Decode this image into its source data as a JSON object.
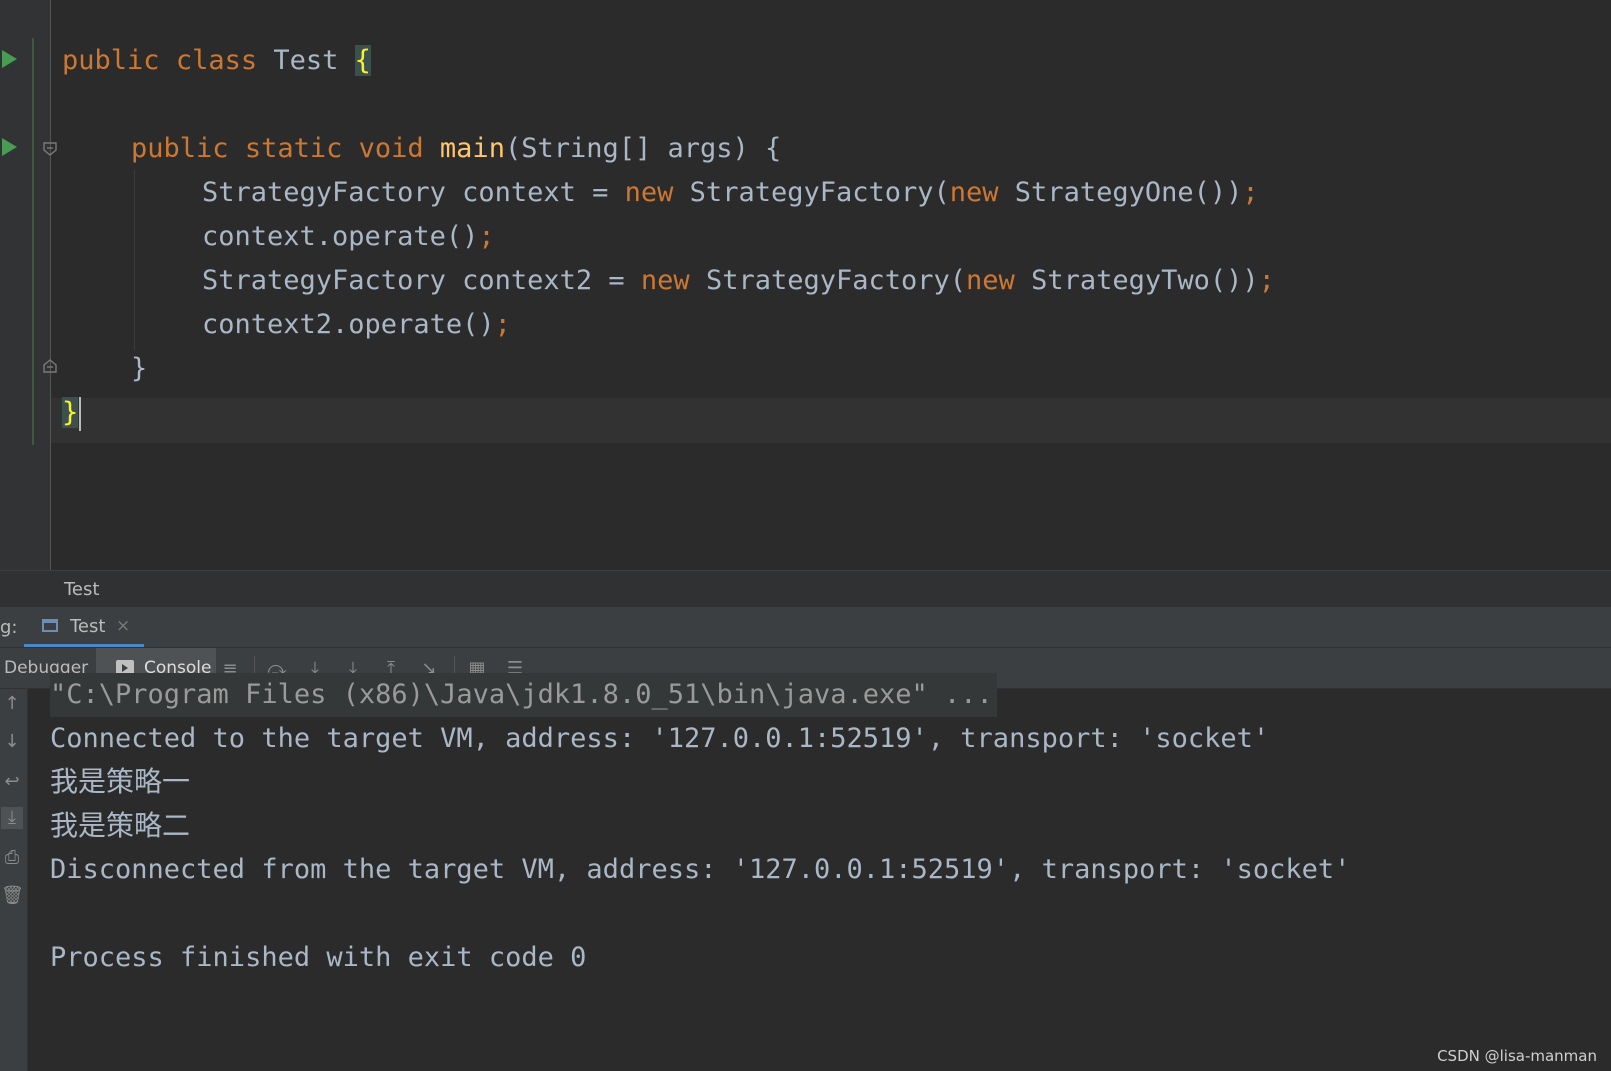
{
  "editor": {
    "lines": {
      "l1": {
        "kw1": "public",
        "kw2": "class",
        "name": "Test",
        "brace": "{"
      },
      "l2": {
        "kw1": "public",
        "kw2": "static",
        "kw3": "void",
        "fn": "main",
        "rest": "(String[] args) {"
      },
      "l3": {
        "a": "StrategyFactory context = ",
        "kw": "new",
        "b": " StrategyFactory(",
        "kw2": "new",
        "c": " StrategyOne())",
        "semi": ";"
      },
      "l4": {
        "a": "context.operate()",
        "semi": ";"
      },
      "l5": {
        "a": "StrategyFactory context2 = ",
        "kw": "new",
        "b": " StrategyFactory(",
        "kw2": "new",
        "c": " StrategyTwo())",
        "semi": ";"
      },
      "l6": {
        "a": "context2.operate()",
        "semi": ";"
      },
      "l7": {
        "a": "}"
      },
      "l8": {
        "a": "}"
      }
    },
    "breadcrumb": "Test"
  },
  "tool_window": {
    "title": "g:",
    "run_tab": {
      "label": "Test",
      "close": "×"
    },
    "tabs": {
      "debugger": "Debugger",
      "console": "Console"
    },
    "toolbar_icons": [
      "menu-icon",
      "show-execution-point-icon",
      "step-over-icon",
      "step-into-icon",
      "step-out-icon",
      "run-to-cursor-icon",
      "evaluate-icon",
      "trace-icon"
    ],
    "side_icons": [
      "up-arrow-icon",
      "down-arrow-icon",
      "soft-wrap-icon",
      "scroll-to-end-icon",
      "print-icon",
      "clear-icon"
    ]
  },
  "console": {
    "cmd": "\"C:\\Program Files (x86)\\Java\\jdk1.8.0_51\\bin\\java.exe\" ...",
    "connected": "Connected to the target VM, address: '127.0.0.1:52519', transport: 'socket'",
    "out1": "我是策略一",
    "out2": "我是策略二",
    "disconnected": "Disconnected from the target VM, address: '127.0.0.1:52519', transport: 'socket'",
    "finished": "Process finished with exit code 0"
  },
  "watermark": "CSDN @lisa-manman",
  "colors": {
    "background": "#2b2b2b",
    "keyword": "#cc7832",
    "function": "#ffc66d",
    "text": "#a9b7c6",
    "run_icon": "#499c54",
    "brace_highlight": "#ffef28"
  }
}
